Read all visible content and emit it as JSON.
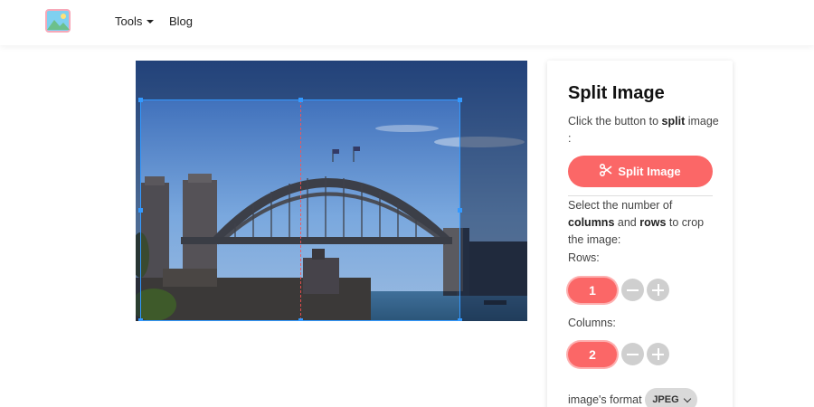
{
  "header": {
    "logo_icon": "image-logo-icon",
    "nav": [
      {
        "label": "Tools"
      },
      {
        "label": "Blog"
      }
    ]
  },
  "canvas": {
    "image_subject": "harbour-bridge-photo",
    "columns_shown": 2,
    "accent_color": "#3399ff"
  },
  "panel": {
    "title": "Split Image",
    "intro_pre": "Click the button to ",
    "intro_bold": "split",
    "intro_post": " image :",
    "split_button_label": "Split Image",
    "split_button_icon": "scissors-icon",
    "select_pre": "Select the number of ",
    "select_bold1": "columns",
    "select_mid": " and ",
    "select_bold2": "rows",
    "select_post": " to crop the image:",
    "rows_label": "Rows:",
    "rows_value": "1",
    "columns_label": "Columns:",
    "columns_value": "2",
    "format_label": "image's format",
    "format_value": "JPEG",
    "brand_color": "#fb6767"
  }
}
